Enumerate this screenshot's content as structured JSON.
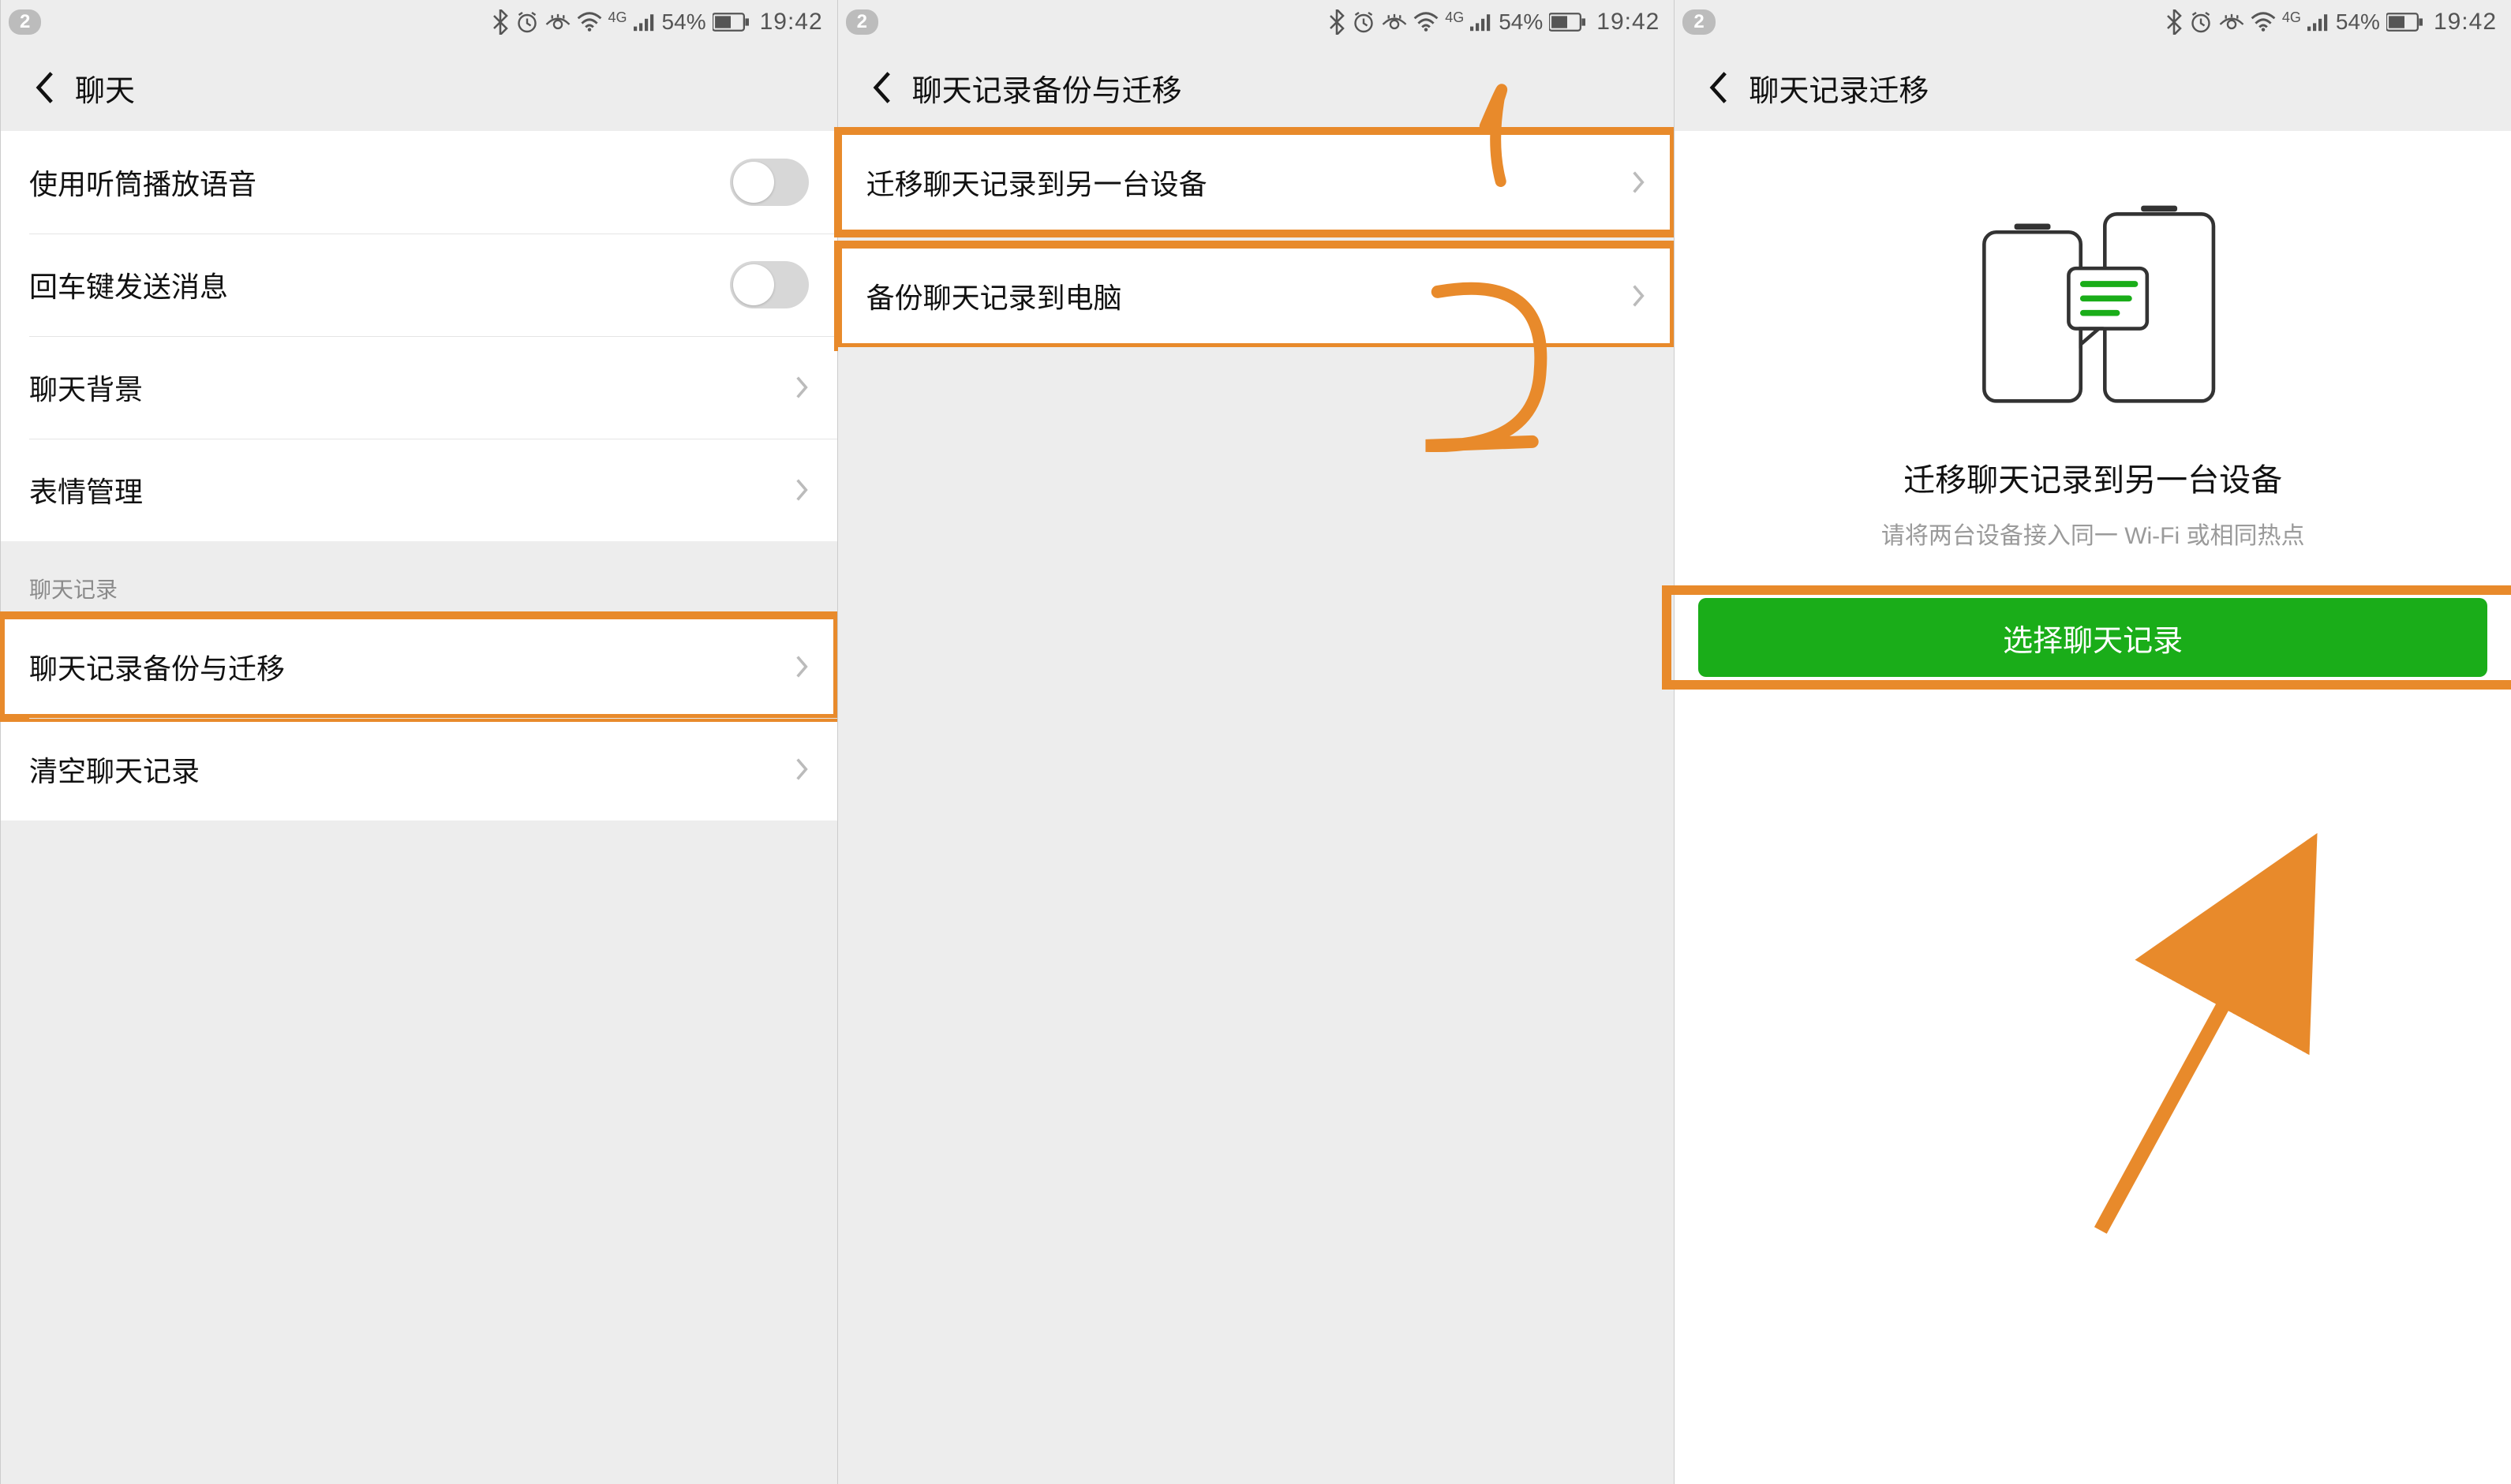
{
  "status": {
    "notif_count": "2",
    "battery_pct": "54%",
    "time": "19:42",
    "net_label": "4G"
  },
  "screen1": {
    "title": "聊天",
    "items": {
      "earpiece": "使用听筒播放语音",
      "enter_send": "回车键发送消息",
      "chat_bg": "聊天背景",
      "sticker_mgr": "表情管理"
    },
    "section_label": "聊天记录",
    "items2": {
      "backup_migrate": "聊天记录备份与迁移",
      "clear": "清空聊天记录"
    }
  },
  "screen2": {
    "title": "聊天记录备份与迁移",
    "items": {
      "migrate_device": "迁移聊天记录到另一台设备",
      "backup_pc": "备份聊天记录到电脑"
    },
    "annot": {
      "one": "1",
      "two": "2"
    }
  },
  "screen3": {
    "title": "聊天记录迁移",
    "heading": "迁移聊天记录到另一台设备",
    "subtitle": "请将两台设备接入同一 Wi-Fi 或相同热点",
    "button": "选择聊天记录"
  }
}
